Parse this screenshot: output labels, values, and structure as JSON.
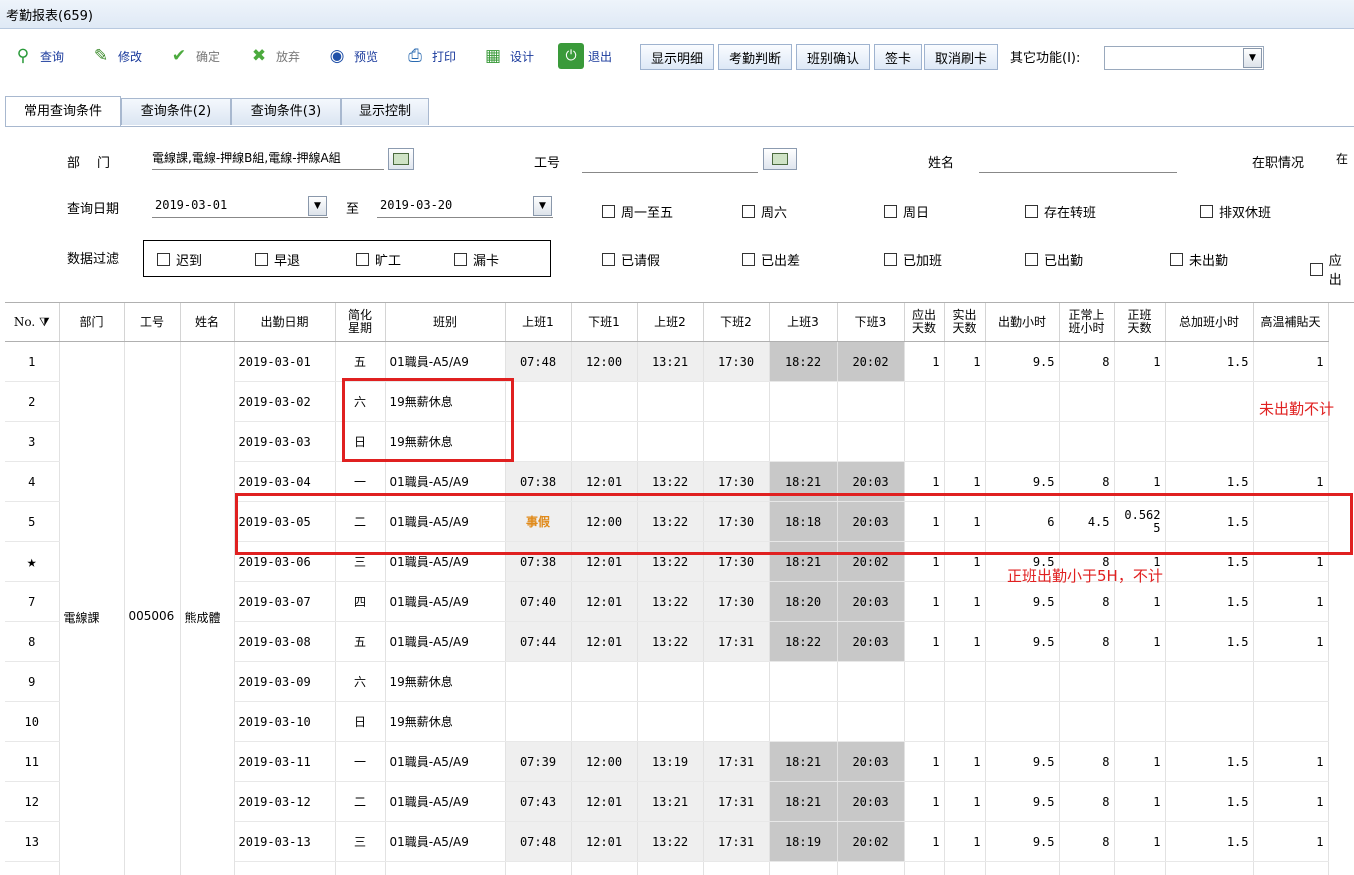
{
  "window": {
    "title": "考勤报表(659)"
  },
  "toolbar": {
    "buttons": [
      {
        "label": "查询",
        "icon": "search-icon"
      },
      {
        "label": "修改",
        "icon": "edit-icon"
      },
      {
        "label": "确定",
        "icon": "check-icon"
      },
      {
        "label": "放弃",
        "icon": "cancel-icon"
      },
      {
        "label": "预览",
        "icon": "preview-icon"
      },
      {
        "label": "打印",
        "icon": "print-icon"
      },
      {
        "label": "设计",
        "icon": "design-icon"
      },
      {
        "label": "退出",
        "icon": "exit-icon"
      }
    ],
    "actions": [
      "显示明细",
      "考勤判断",
      "班别确认",
      "签卡",
      "取消刷卡"
    ],
    "other_label": "其它功能(I):",
    "other_value": ""
  },
  "tabs": [
    "常用查询条件",
    "查询条件(2)",
    "查询条件(3)",
    "显示控制"
  ],
  "query": {
    "dept_label": "部　门",
    "dept_value": "電線課,電線-押線B組,電線-押線A組",
    "empno_label": "工号",
    "empno_value": "",
    "name_label": "姓名",
    "name_value": "",
    "status_label": "在职情况",
    "status_value": "在",
    "date_label": "查询日期",
    "date_from": "2019-03-01",
    "to_label": "至",
    "date_to": "2019-03-20",
    "filter_label": "数据过滤",
    "filter_checks": [
      "迟到",
      "早退",
      "旷工",
      "漏卡"
    ],
    "row1_checks": [
      "周一至五",
      "周六",
      "周日",
      "存在转班",
      "排双休班"
    ],
    "row2_checks": [
      "已请假",
      "已出差",
      "已加班",
      "已出勤",
      "未出勤",
      "应出"
    ]
  },
  "grid": {
    "headers": [
      "No.",
      "部门",
      "工号",
      "姓名",
      "出勤日期",
      "简化\n星期",
      "班别",
      "上班1",
      "下班1",
      "上班2",
      "下班2",
      "上班3",
      "下班3",
      "应出\n天数",
      "实出\n天数",
      "出勤小时",
      "正常上\n班小时",
      "正班\n天数",
      "总加班小时",
      "高温補貼天"
    ],
    "dept": "電線課",
    "empno": "005006",
    "name": "熊成體",
    "rows": [
      {
        "no": "1",
        "date": "2019-03-01",
        "wd": "五",
        "shift": "01職員-A5/A9",
        "in1": "07:48",
        "out1": "12:00",
        "in2": "13:21",
        "out2": "17:30",
        "in3": "18:22",
        "out3": "20:02",
        "due": "1",
        "act": "1",
        "hrs": "9.5",
        "norm": "8",
        "days": "1",
        "ot": "1.5",
        "hot": "1"
      },
      {
        "no": "2",
        "date": "2019-03-02",
        "wd": "六",
        "shift": "19無薪休息",
        "in1": "",
        "out1": "",
        "in2": "",
        "out2": "",
        "in3": "",
        "out3": "",
        "due": "",
        "act": "",
        "hrs": "",
        "norm": "",
        "days": "",
        "ot": "",
        "hot": ""
      },
      {
        "no": "3",
        "date": "2019-03-03",
        "wd": "日",
        "shift": "19無薪休息",
        "in1": "",
        "out1": "",
        "in2": "",
        "out2": "",
        "in3": "",
        "out3": "",
        "due": "",
        "act": "",
        "hrs": "",
        "norm": "",
        "days": "",
        "ot": "",
        "hot": ""
      },
      {
        "no": "4",
        "date": "2019-03-04",
        "wd": "一",
        "shift": "01職員-A5/A9",
        "in1": "07:38",
        "out1": "12:01",
        "in2": "13:22",
        "out2": "17:30",
        "in3": "18:21",
        "out3": "20:03",
        "due": "1",
        "act": "1",
        "hrs": "9.5",
        "norm": "8",
        "days": "1",
        "ot": "1.5",
        "hot": "1"
      },
      {
        "no": "5",
        "date": "2019-03-05",
        "wd": "二",
        "shift": "01職員-A5/A9",
        "in1": "事假",
        "out1": "12:00",
        "in2": "13:22",
        "out2": "17:30",
        "in3": "18:18",
        "out3": "20:03",
        "due": "1",
        "act": "1",
        "hrs": "6",
        "norm": "4.5",
        "days": "0.562\n5",
        "ot": "1.5",
        "hot": ""
      },
      {
        "no": "★",
        "date": "2019-03-06",
        "wd": "三",
        "shift": "01職員-A5/A9",
        "in1": "07:38",
        "out1": "12:01",
        "in2": "13:22",
        "out2": "17:30",
        "in3": "18:21",
        "out3": "20:02",
        "due": "1",
        "act": "1",
        "hrs": "9.5",
        "norm": "8",
        "days": "1",
        "ot": "1.5",
        "hot": "1"
      },
      {
        "no": "7",
        "date": "2019-03-07",
        "wd": "四",
        "shift": "01職員-A5/A9",
        "in1": "07:40",
        "out1": "12:01",
        "in2": "13:22",
        "out2": "17:30",
        "in3": "18:20",
        "out3": "20:03",
        "due": "1",
        "act": "1",
        "hrs": "9.5",
        "norm": "8",
        "days": "1",
        "ot": "1.5",
        "hot": "1"
      },
      {
        "no": "8",
        "date": "2019-03-08",
        "wd": "五",
        "shift": "01職員-A5/A9",
        "in1": "07:44",
        "out1": "12:01",
        "in2": "13:22",
        "out2": "17:31",
        "in3": "18:22",
        "out3": "20:03",
        "due": "1",
        "act": "1",
        "hrs": "9.5",
        "norm": "8",
        "days": "1",
        "ot": "1.5",
        "hot": "1"
      },
      {
        "no": "9",
        "date": "2019-03-09",
        "wd": "六",
        "shift": "19無薪休息",
        "in1": "",
        "out1": "",
        "in2": "",
        "out2": "",
        "in3": "",
        "out3": "",
        "due": "",
        "act": "",
        "hrs": "",
        "norm": "",
        "days": "",
        "ot": "",
        "hot": ""
      },
      {
        "no": "10",
        "date": "2019-03-10",
        "wd": "日",
        "shift": "19無薪休息",
        "in1": "",
        "out1": "",
        "in2": "",
        "out2": "",
        "in3": "",
        "out3": "",
        "due": "",
        "act": "",
        "hrs": "",
        "norm": "",
        "days": "",
        "ot": "",
        "hot": ""
      },
      {
        "no": "11",
        "date": "2019-03-11",
        "wd": "一",
        "shift": "01職員-A5/A9",
        "in1": "07:39",
        "out1": "12:00",
        "in2": "13:19",
        "out2": "17:31",
        "in3": "18:21",
        "out3": "20:03",
        "due": "1",
        "act": "1",
        "hrs": "9.5",
        "norm": "8",
        "days": "1",
        "ot": "1.5",
        "hot": "1"
      },
      {
        "no": "12",
        "date": "2019-03-12",
        "wd": "二",
        "shift": "01職員-A5/A9",
        "in1": "07:43",
        "out1": "12:01",
        "in2": "13:21",
        "out2": "17:31",
        "in3": "18:21",
        "out3": "20:03",
        "due": "1",
        "act": "1",
        "hrs": "9.5",
        "norm": "8",
        "days": "1",
        "ot": "1.5",
        "hot": "1"
      },
      {
        "no": "13",
        "date": "2019-03-13",
        "wd": "三",
        "shift": "01職員-A5/A9",
        "in1": "07:48",
        "out1": "12:01",
        "in2": "13:22",
        "out2": "17:31",
        "in3": "18:19",
        "out3": "20:02",
        "due": "1",
        "act": "1",
        "hrs": "9.5",
        "norm": "8",
        "days": "1",
        "ot": "1.5",
        "hot": "1"
      },
      {
        "no": "",
        "date": "",
        "wd": "",
        "shift": "",
        "in1": "",
        "out1": "",
        "in2": "",
        "out2": "",
        "in3": "",
        "out3": "",
        "due": "",
        "act": "",
        "hrs": "",
        "norm": "",
        "days": "",
        "ot": "",
        "hot": ""
      }
    ]
  },
  "annotations": {
    "note_rest": "未出勤不计",
    "note_leave": "正班出勤小于5H，不计"
  }
}
